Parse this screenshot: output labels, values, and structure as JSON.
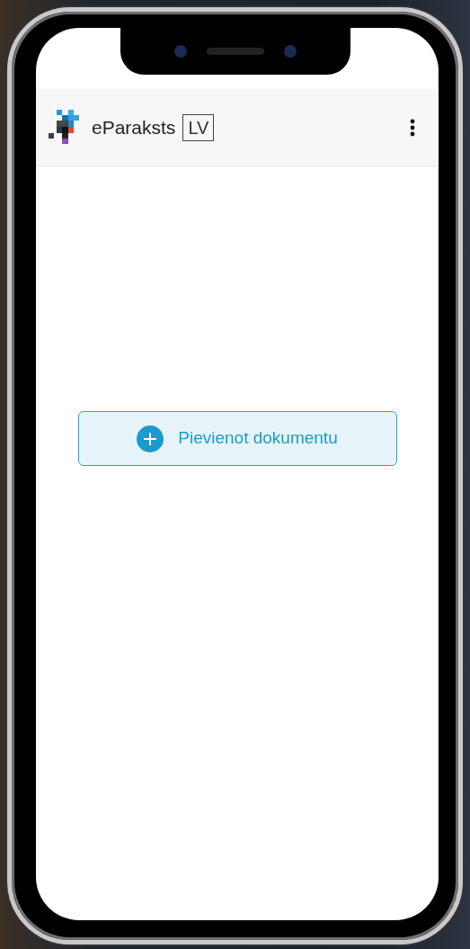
{
  "app_bar": {
    "brand": "eParaksts",
    "region": "LV"
  },
  "action": {
    "label": "Pievienot dokumentu"
  }
}
